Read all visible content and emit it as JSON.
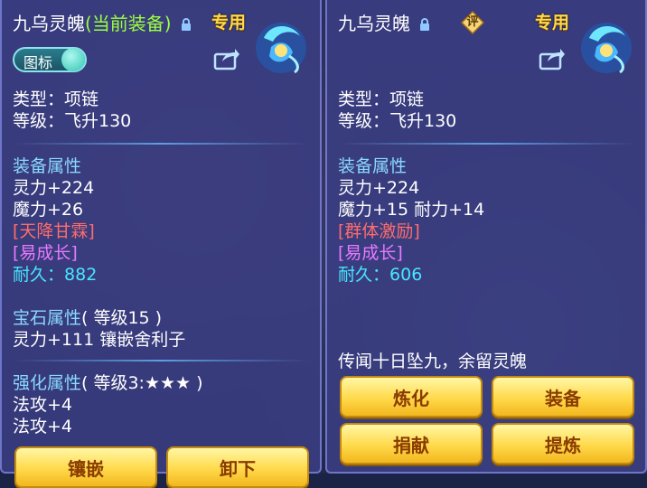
{
  "left": {
    "name": "九乌灵魄",
    "equipped_tag": "(当前装备)",
    "exclusive_tag": "专用",
    "icon_toggle_label": "图标",
    "type_line": "类型：项链",
    "level_line": "等级：飞升130",
    "attr_header": "装备属性",
    "stats": [
      "灵力+224",
      "魔力+26"
    ],
    "special_effect": "[天降甘霖]",
    "special_skill": "[易成长]",
    "durability_label": "耐久：",
    "durability_value": "882",
    "gem_header": "宝石属性",
    "gem_level": "( 等级15 )",
    "gem_line": "灵力+111 镶嵌舍利子",
    "enhance_header": "强化属性",
    "enhance_level": "( 等级3:★★★ )",
    "enhance_lines": [
      "法攻+4",
      "法攻+4"
    ],
    "buttons": {
      "inlay": "镶嵌",
      "unequip": "卸下"
    }
  },
  "right": {
    "name": "九乌灵魄",
    "rating_badge": "评",
    "exclusive_tag": "专用",
    "type_line": "类型：项链",
    "level_line": "等级：飞升130",
    "attr_header": "装备属性",
    "stats": [
      "灵力+224",
      "魔力+15 耐力+14"
    ],
    "special_effect": "[群体激励]",
    "special_skill": "[易成长]",
    "durability_label": "耐久：",
    "durability_value": "606",
    "lore": "传闻十日坠九，余留灵魄",
    "buttons": {
      "refine": "炼化",
      "equip": "装备",
      "donate": "捐献",
      "extract": "提炼"
    }
  },
  "colors": {
    "panel": "#3a3e82",
    "section": "#8ad8ff",
    "effect_red": "#ff6c6c",
    "skill_purple": "#e77aff",
    "durability_cyan": "#48e6ff",
    "equipped_green": "#9aff3e",
    "exclusive_gold": "#ffd84a"
  }
}
